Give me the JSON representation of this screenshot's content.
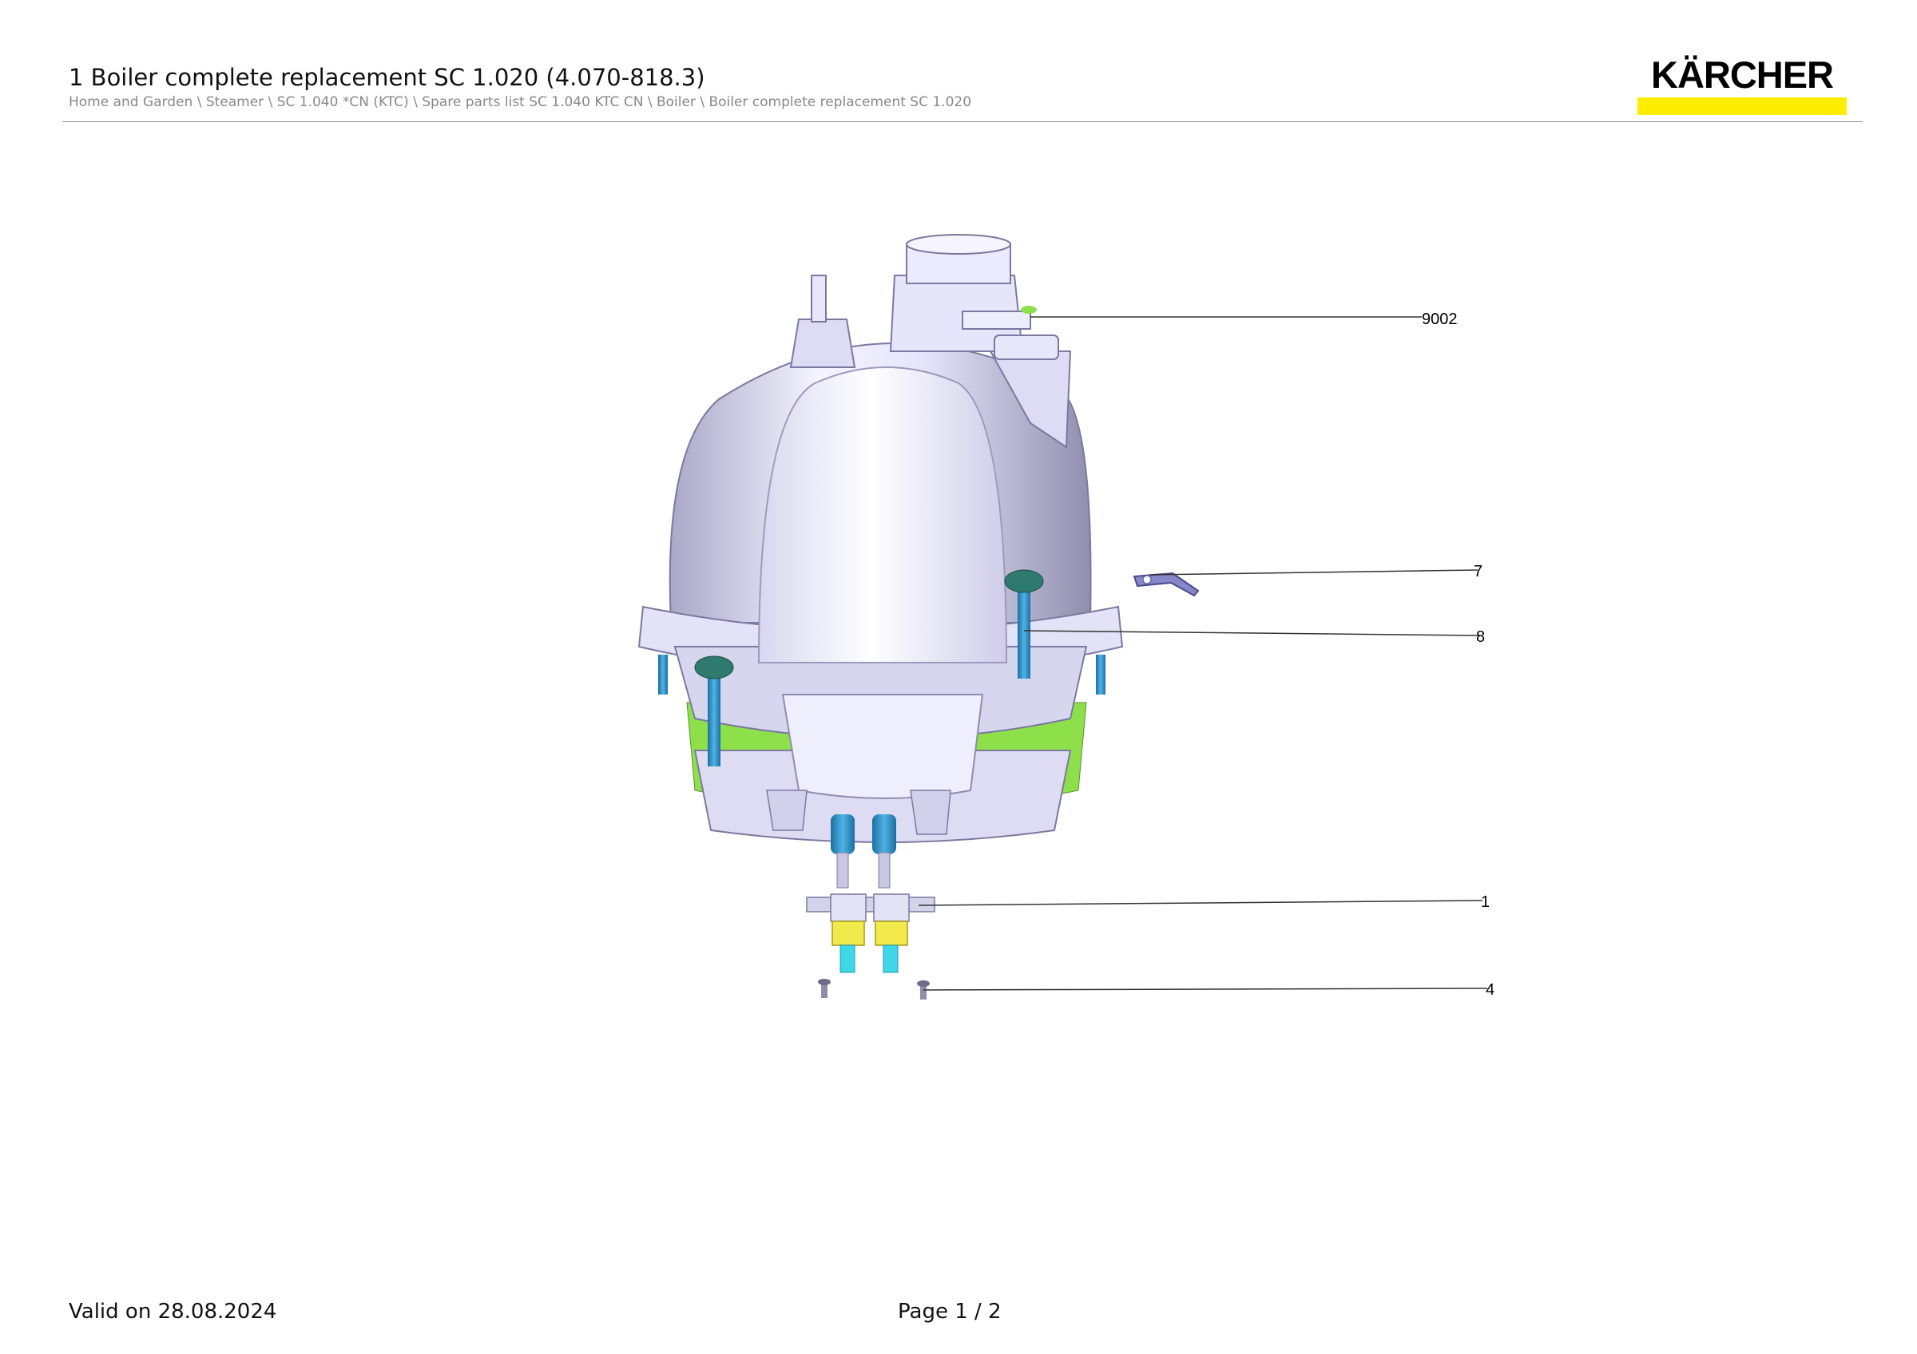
{
  "header": {
    "title": "1 Boiler complete replacement SC 1.020 (4.070-818.3)",
    "breadcrumb": "Home and Garden \\ Steamer \\ SC 1.040 *CN (KTC) \\ Spare parts list SC 1.040 KTC CN \\ Boiler \\ Boiler complete replacement SC 1.020"
  },
  "logo": {
    "text": "KÄRCHER",
    "brand_color": "#ffed00"
  },
  "callouts": {
    "c9002": "9002",
    "c7": "7",
    "c8": "8",
    "c1": "1",
    "c4": "4"
  },
  "footer": {
    "valid": "Valid on 28.08.2024",
    "page": "Page 1 / 2"
  },
  "colors": {
    "body": "#d9d8f2",
    "screw": "#2f8fc4",
    "green": "#8ee04a",
    "terminal": "#f2ea4a",
    "connector": "#3fd7e6"
  }
}
